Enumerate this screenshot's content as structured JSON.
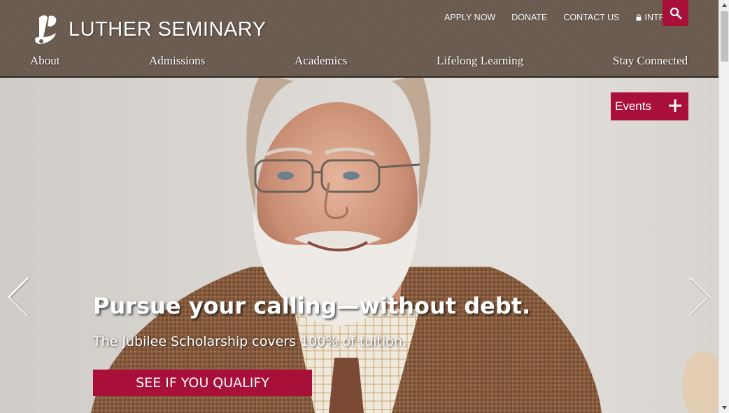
{
  "brand": {
    "name": "LUTHER SEMINARY"
  },
  "utility_nav": [
    {
      "label": "APPLY NOW"
    },
    {
      "label": "DONATE"
    },
    {
      "label": "CONTACT US"
    },
    {
      "label": "INTRANET"
    }
  ],
  "main_nav": [
    {
      "label": "About"
    },
    {
      "label": "Admissions"
    },
    {
      "label": "Academics"
    },
    {
      "label": "Lifelong Learning"
    },
    {
      "label": "Stay Connected"
    }
  ],
  "hero": {
    "events_label": "Events",
    "headline": "Pursue your calling—without debt.",
    "subhead": "The Jubilee Scholarship covers 100% of tuition.",
    "cta_label": "SEE IF YOU QUALIFY"
  },
  "icons": {
    "search": "search-icon",
    "lock": "lock-icon",
    "plus": "plus-icon",
    "prev": "chevron-left-icon",
    "next": "chevron-right-icon"
  },
  "colors": {
    "accent": "#a8103a",
    "header": "#6a5a4e"
  }
}
